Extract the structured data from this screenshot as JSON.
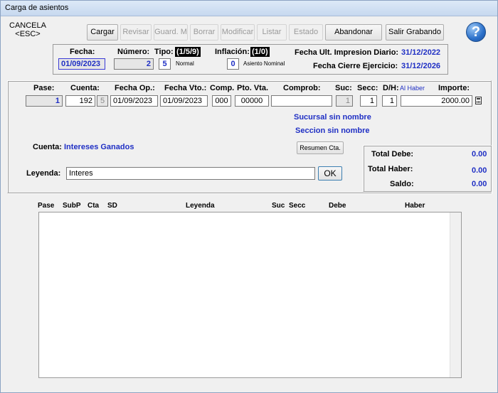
{
  "window": {
    "title": "Carga de asientos"
  },
  "toolbar": {
    "cancel_line1": "CANCELA",
    "cancel_line2": "<ESC>",
    "cargar": "Cargar",
    "revisar": "Revisar",
    "guardm": "Guard. M",
    "borrar": "Borrar",
    "modificar": "Modificar",
    "listar": "Listar",
    "estado": "Estado",
    "abandonar": "Abandonar",
    "salir": "Salir Grabando",
    "help": "?"
  },
  "header": {
    "fecha_label": "Fecha:",
    "fecha_value": "01/09/2023",
    "numero_label": "Número:",
    "numero_value": "2",
    "tipo_label": "Tipo:",
    "tipo_codes": "(1/5/9)",
    "tipo_value": "5",
    "tipo_desc": "Normal",
    "inflacion_label": "Inflación:",
    "inflacion_codes": "(1/0)",
    "inflacion_value": "0",
    "inflacion_desc": "Asiento Nominal",
    "ult_impresion_label": "Fecha Ult. Impresion Diario:",
    "ult_impresion_value": "31/12/2022",
    "cierre_label": "Fecha Cierre Ejercicio:",
    "cierre_value": "31/12/2026"
  },
  "entry": {
    "labels": {
      "pase": "Pase:",
      "cuenta": "Cuenta:",
      "fecha_op": "Fecha Op.:",
      "fecha_vto": "Fecha Vto.:",
      "comp": "Comp.",
      "pto_vta": "Pto. Vta.",
      "comprob": "Comprob:",
      "suc": "Suc:",
      "secc": "Secc:",
      "dh": "D/H:",
      "dh_hint": "Al Haber",
      "importe": "Importe:"
    },
    "values": {
      "pase": "1",
      "cuenta": "192",
      "cuenta_sub": "5",
      "fecha_op": "01/09/2023",
      "fecha_vto": "01/09/2023",
      "comp": "000",
      "pto_vta": "00000",
      "comprob": "",
      "suc": "1",
      "secc": "1",
      "dh": "1",
      "importe": "2000.00"
    },
    "sucursal_text": "Sucursal sin nombre",
    "seccion_text": "Seccion sin nombre",
    "cuenta_label": "Cuenta:",
    "cuenta_name": "Intereses Ganados",
    "resumen_button": "Resumen Cta.",
    "leyenda_label": "Leyenda:",
    "leyenda_value": "Interes",
    "ok_button": "OK"
  },
  "totals": {
    "debe_label": "Total Debe:",
    "debe_value": "0.00",
    "haber_label": "Total Haber:",
    "haber_value": "0.00",
    "saldo_label": "Saldo:",
    "saldo_value": "0.00"
  },
  "grid": {
    "columns": [
      "Pase",
      "SubP",
      "Cta",
      "SD",
      "Leyenda",
      "Suc",
      "Secc",
      "Debe",
      "Haber"
    ],
    "rows": []
  }
}
